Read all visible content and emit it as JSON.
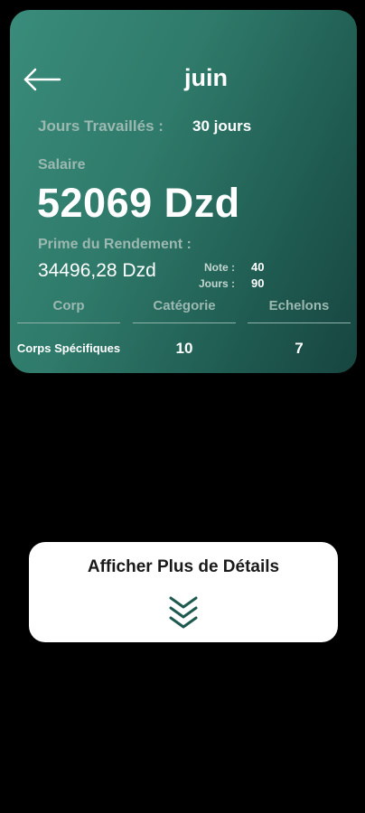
{
  "header": {
    "month": "juin"
  },
  "work": {
    "days_label": "Jours Travaillés :",
    "days_value": "30 jours"
  },
  "salary": {
    "label": "Salaire",
    "value": "52069 Dzd"
  },
  "prime": {
    "label": "Prime du Rendement :",
    "value": "34496,28 Dzd",
    "note_label": "Note :",
    "note_value": "40",
    "jours_label": "Jours :",
    "jours_value": "90"
  },
  "grade": {
    "columns": [
      {
        "header": "Corp",
        "value": "Corps Spécifiques"
      },
      {
        "header": "Catégorie",
        "value": "10"
      },
      {
        "header": "Echelons",
        "value": "7"
      }
    ]
  },
  "details": {
    "label": "Afficher Plus de Détails",
    "icon": "double-chevron-down-icon"
  },
  "colors": {
    "card_gradient_start": "#3a8c7b",
    "card_gradient_end": "#174540",
    "muted_text": "#9bb8b1",
    "chevron": "#1f5a50",
    "background": "#000000"
  }
}
